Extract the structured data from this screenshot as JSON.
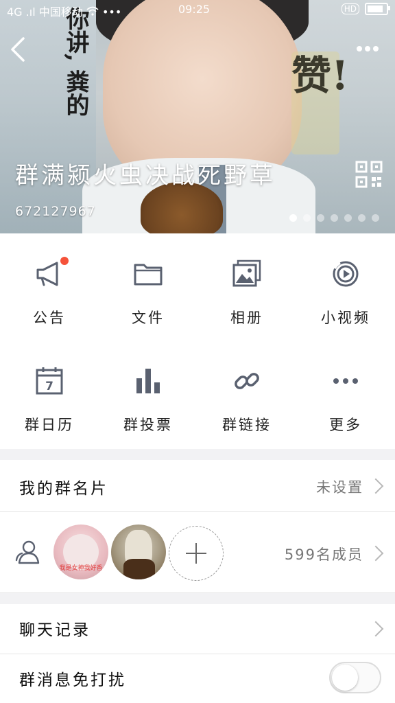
{
  "status_bar": {
    "network": "4G .ıl",
    "carrier": "中国移动",
    "extra": "•••",
    "time": "09:25",
    "hd": "HD",
    "battery_level": 0.9
  },
  "header": {
    "group_name": "群满颍火虫决战死野草",
    "group_id": "672127967",
    "carousel": {
      "count": 7,
      "active_index": 0
    }
  },
  "image_text": {
    "sign": "赞!",
    "side": "你讲, 粪的"
  },
  "features": [
    {
      "label": "公告",
      "icon": "megaphone-icon",
      "has_badge": true
    },
    {
      "label": "文件",
      "icon": "folder-icon",
      "has_badge": false
    },
    {
      "label": "相册",
      "icon": "album-icon",
      "has_badge": false
    },
    {
      "label": "小视频",
      "icon": "video-icon",
      "has_badge": false
    },
    {
      "label": "群日历",
      "icon": "calendar-icon",
      "calendar_day": "7",
      "has_badge": false
    },
    {
      "label": "群投票",
      "icon": "vote-icon",
      "has_badge": false
    },
    {
      "label": "群链接",
      "icon": "link-icon",
      "has_badge": false
    },
    {
      "label": "更多",
      "icon": "more-dots-icon",
      "has_badge": false
    }
  ],
  "name_card": {
    "title": "我的群名片",
    "value": "未设置"
  },
  "members": {
    "count_text": "599名成员",
    "avatar1_caption": "我是女神我好香"
  },
  "chat_history": {
    "title": "聊天记录"
  },
  "mute": {
    "title": "群消息免打扰",
    "enabled": false
  },
  "colors": {
    "badge": "#f5523a",
    "icon": "#5a6170"
  }
}
